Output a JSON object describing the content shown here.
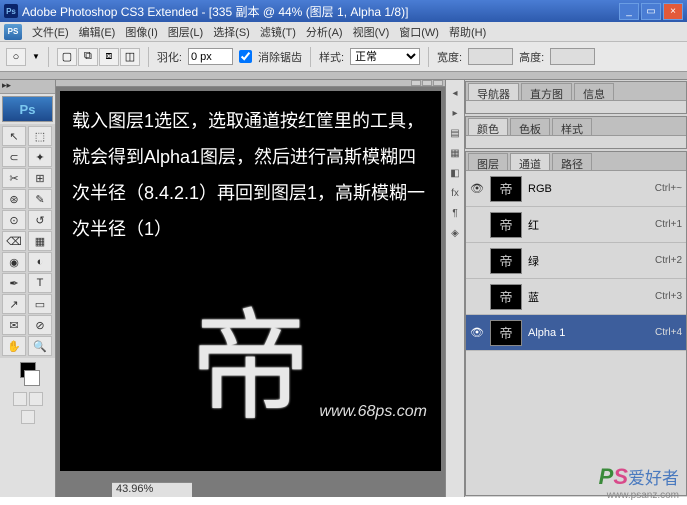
{
  "title": "Adobe Photoshop CS3 Extended - [335 副本 @ 44% (图层 1, Alpha 1/8)]",
  "menu": {
    "file": "文件(E)",
    "edit": "编辑(E)",
    "image": "图像(I)",
    "layer": "图层(L)",
    "select": "选择(S)",
    "filter": "滤镜(T)",
    "analysis": "分析(A)",
    "view": "视图(V)",
    "window": "窗口(W)",
    "help": "帮助(H)"
  },
  "options": {
    "feather_label": "羽化:",
    "feather_value": "0 px",
    "antialias": "消除锯齿",
    "style_label": "样式:",
    "style_value": "正常",
    "width_label": "宽度:",
    "height_label": "高度:"
  },
  "toolbox_header": "▸▸",
  "canvas": {
    "instruction": "载入图层1选区，选取通道按红筐里的工具，就会得到Alpha1图层，然后进行高斯模糊四次半径（8.4.2.1）再回到图层1，高斯模糊一次半径（1）",
    "glyph": "帝",
    "watermark": "www.68ps.com"
  },
  "panels": {
    "nav": {
      "t1": "导航器",
      "t2": "直方图",
      "t3": "信息"
    },
    "color": {
      "t1": "颜色",
      "t2": "色板",
      "t3": "样式"
    },
    "layers": {
      "t1": "图层",
      "t2": "通道",
      "t3": "路径"
    }
  },
  "channels": [
    {
      "name": "RGB",
      "shortcut": "Ctrl+~",
      "eye": true,
      "sel": false
    },
    {
      "name": "红",
      "shortcut": "Ctrl+1",
      "eye": false,
      "sel": false
    },
    {
      "name": "绿",
      "shortcut": "Ctrl+2",
      "eye": false,
      "sel": false
    },
    {
      "name": "蓝",
      "shortcut": "Ctrl+3",
      "eye": false,
      "sel": false
    },
    {
      "name": "Alpha 1",
      "shortcut": "Ctrl+4",
      "eye": true,
      "sel": true
    }
  ],
  "status": {
    "zoom": "43.96%"
  },
  "branding": {
    "p": "P",
    "s": "S",
    "cn": "爱好者",
    "url": "www.psanz.com"
  }
}
